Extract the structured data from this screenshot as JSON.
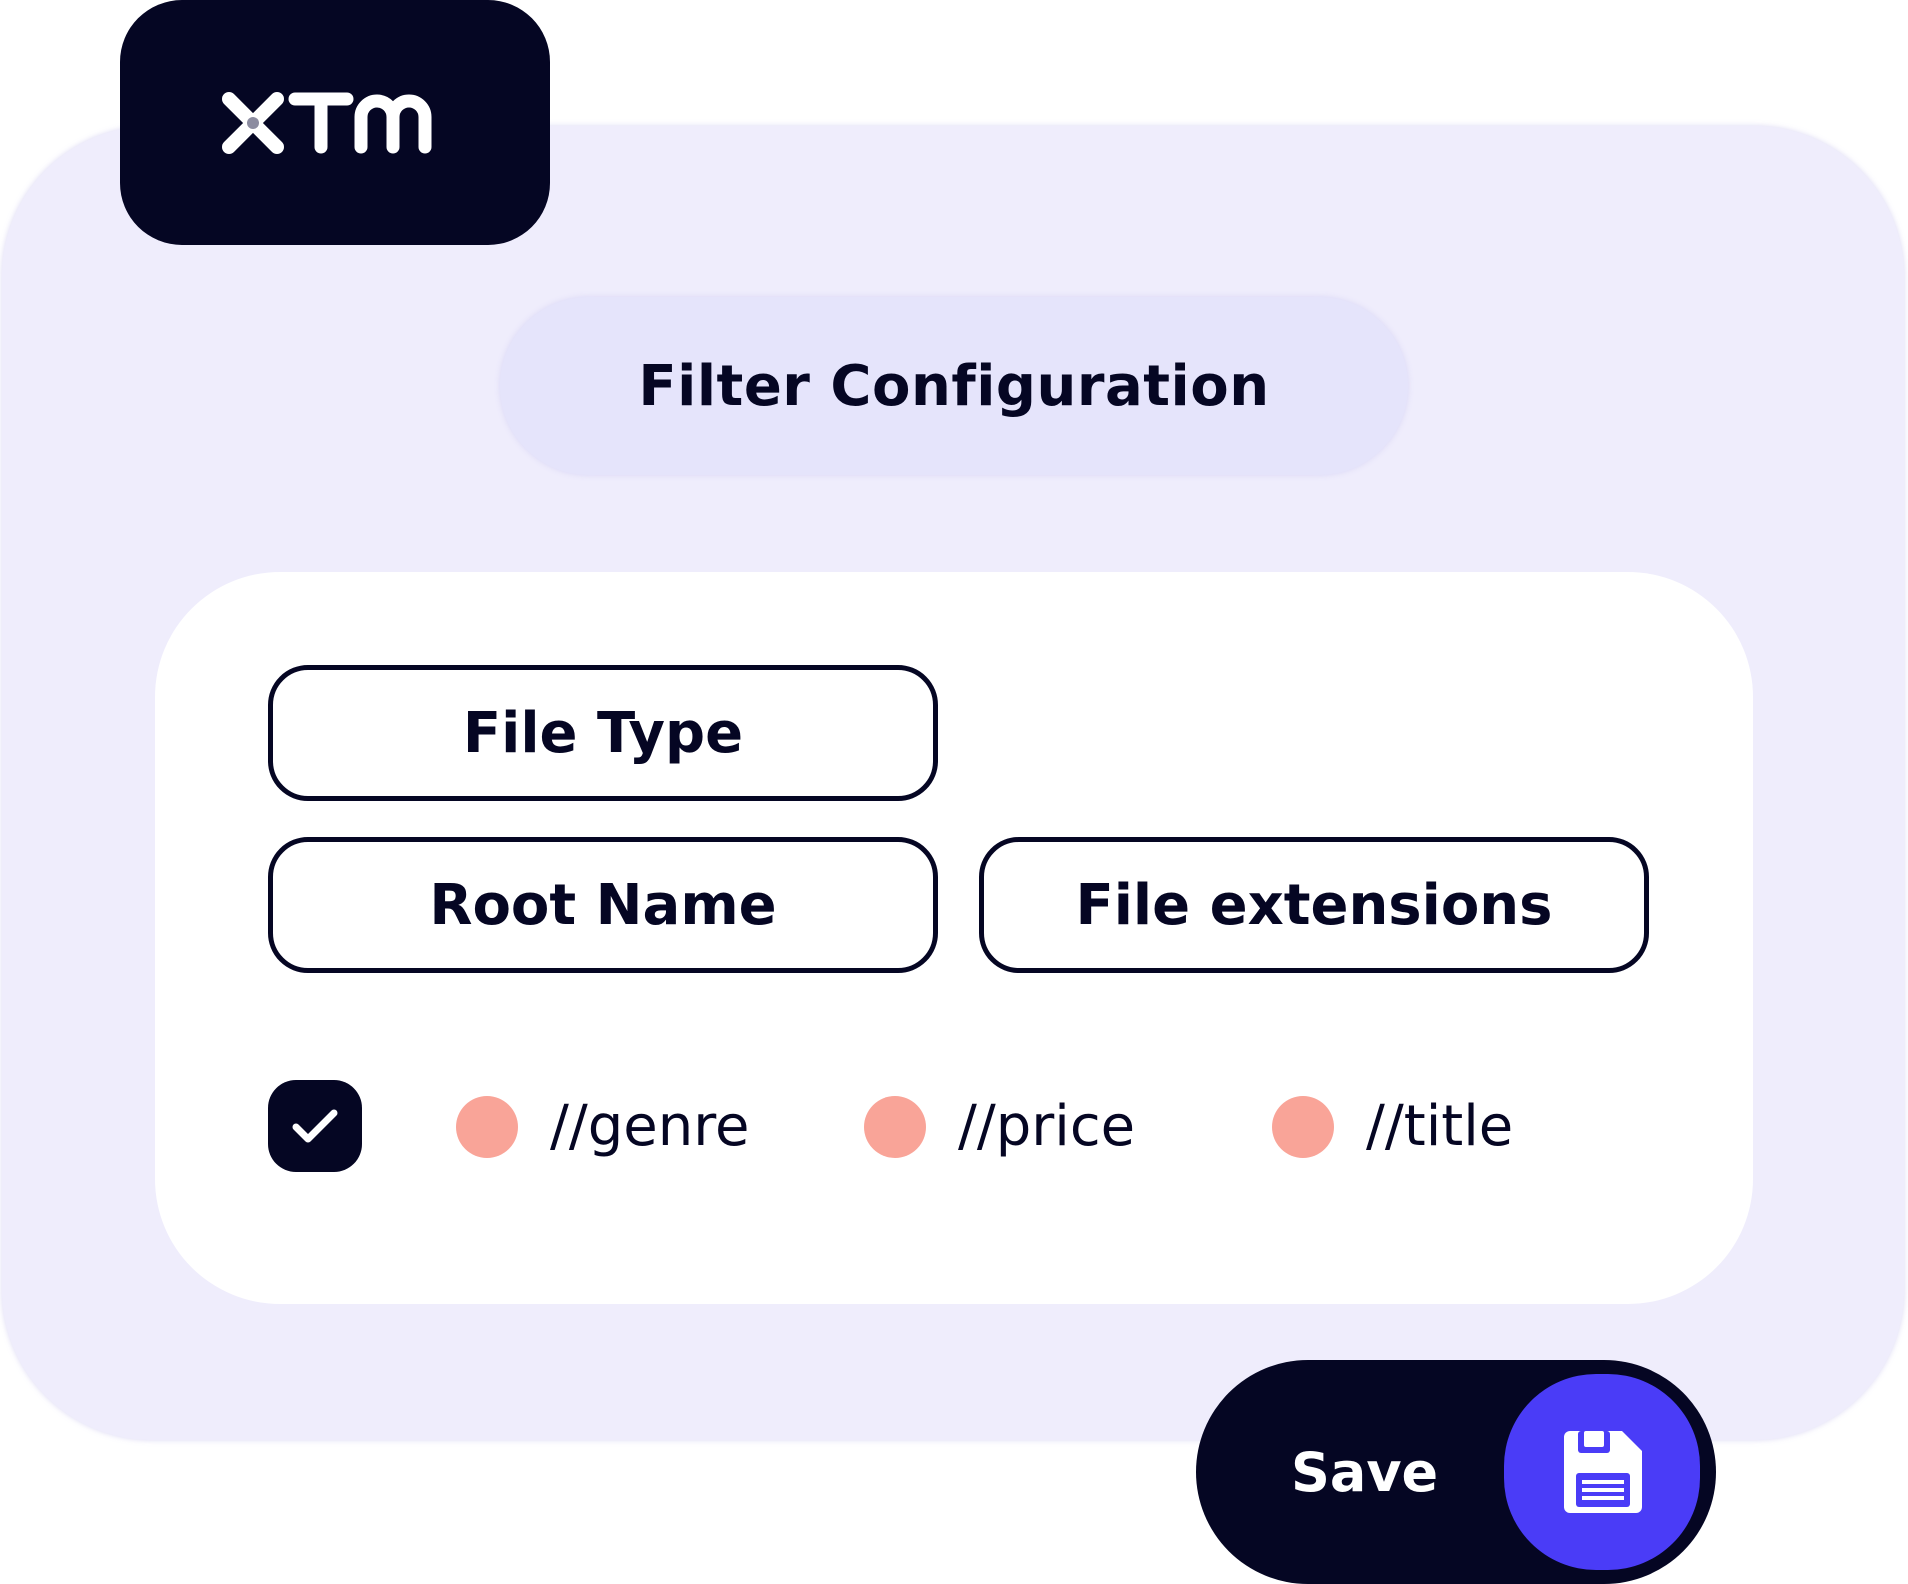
{
  "brand": {
    "logo_text": "XTM",
    "logo_icon": "xtm-logo-icon"
  },
  "header": {
    "title": "Filter Configuration"
  },
  "fields": {
    "file_type": "File Type",
    "root_name": "Root Name",
    "file_extensions": "File extensions"
  },
  "options": {
    "checkbox_checked": true,
    "checkbox_icon": "check-icon",
    "tokens": [
      {
        "label": "//genre"
      },
      {
        "label": "//price"
      },
      {
        "label": "//title"
      }
    ]
  },
  "footer": {
    "save_label": "Save",
    "save_icon": "floppy-disk-icon"
  },
  "colors": {
    "navy": "#050623",
    "lavender": "#efedfc",
    "pill": "#e5e4fb",
    "coral": "#f9a498",
    "accent": "#4a3cf7",
    "white": "#ffffff"
  }
}
